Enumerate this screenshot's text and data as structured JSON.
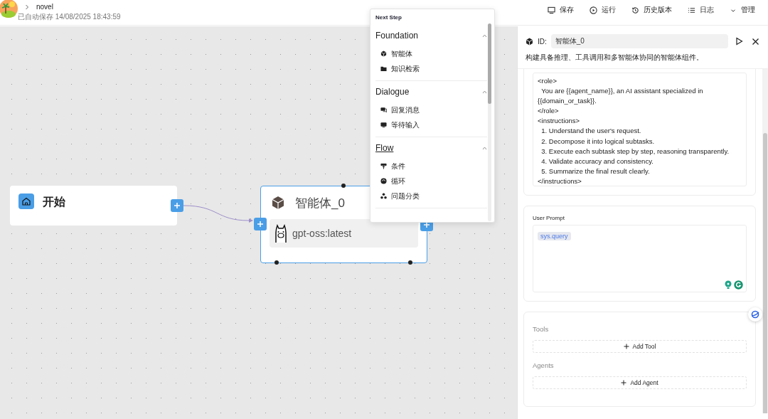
{
  "header": {
    "breadcrumb": "novel",
    "autosave": "已自动保存 14/08/2025 18:43:59"
  },
  "toolbar": [
    {
      "label": "保存",
      "kind": "save"
    },
    {
      "label": "运行",
      "kind": "run"
    },
    {
      "label": "历史版本",
      "kind": "history"
    },
    {
      "label": "日志",
      "kind": "log"
    },
    {
      "label": "管理",
      "kind": "manage"
    }
  ],
  "canvas": {
    "start_node": {
      "title": "开始"
    },
    "agent_node": {
      "title": "智能体_0",
      "model": "gpt-oss:latest",
      "selected": true
    }
  },
  "menu": {
    "title": "Next Step",
    "sections": [
      {
        "title": "Foundation",
        "expanded": true,
        "hovered": false,
        "items": [
          {
            "label": "智能体",
            "kind": "agent"
          },
          {
            "label": "知识检索",
            "kind": "retrieval"
          }
        ]
      },
      {
        "title": "Dialogue",
        "expanded": true,
        "hovered": false,
        "items": [
          {
            "label": "回复消息",
            "kind": "reply"
          },
          {
            "label": "等待输入",
            "kind": "input"
          }
        ]
      },
      {
        "title": "Flow",
        "expanded": true,
        "hovered": true,
        "items": [
          {
            "label": "条件",
            "kind": "condition"
          },
          {
            "label": "循环",
            "kind": "loop"
          },
          {
            "label": "问题分类",
            "kind": "classify"
          }
        ]
      }
    ]
  },
  "panel": {
    "id_label": "ID:",
    "id_value": "智能体_0",
    "description": "构建具备推理、工具调用和多智能体协同的智能体组件。",
    "system_prompt": "<role>\n  You are {{agent_name}}, an AI assistant specialized in\n{{domain_or_task}}.\n</role>\n<instructions>\n  1. Understand the user's request.\n  2. Decompose it into logical subtasks.\n  3. Execute each subtask step by step, reasoning transparently.\n  4. Validate accuracy and consistency.\n  5. Summarize the final result clearly.\n</instructions>",
    "user_prompt": {
      "label": "User Prompt",
      "variable": "sys.query"
    },
    "tools": {
      "label": "Tools",
      "button": "Add Tool"
    },
    "agents": {
      "label": "Agents",
      "button": "Add Agent"
    }
  }
}
